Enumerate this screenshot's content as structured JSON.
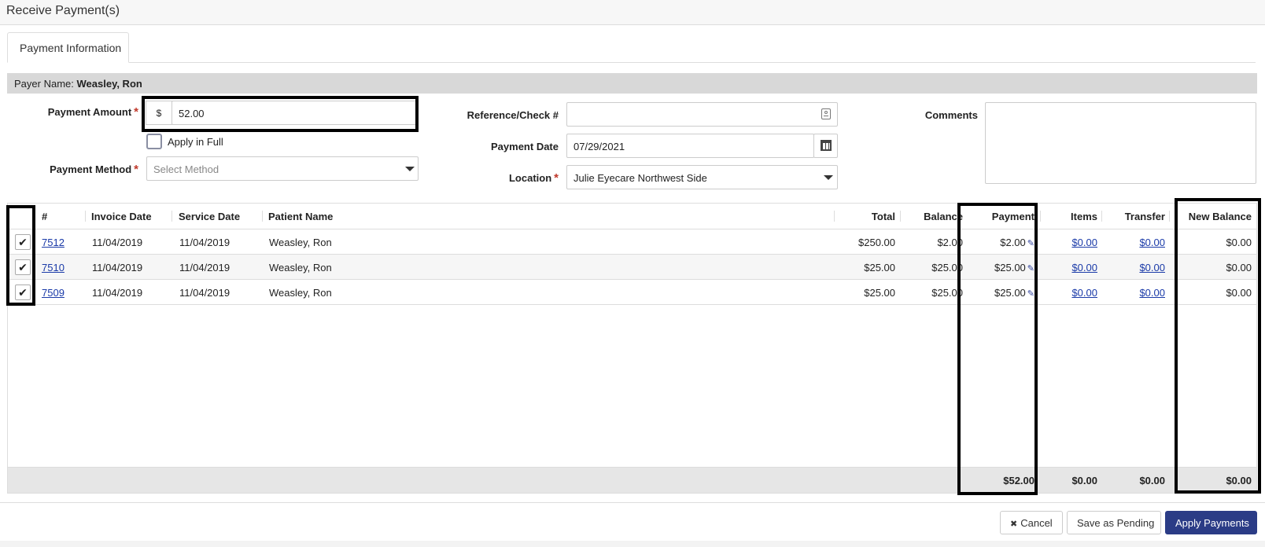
{
  "window": {
    "title": "Receive Payment(s)"
  },
  "tabs": [
    {
      "label": "Payment Information"
    }
  ],
  "payer": {
    "label": "Payer Name:",
    "name": "Weasley, Ron"
  },
  "form": {
    "payment_amount": {
      "label": "Payment Amount",
      "currency": "$",
      "value": "52.00"
    },
    "apply_in_full": {
      "label": "Apply in Full",
      "checked": false
    },
    "payment_method": {
      "label": "Payment Method",
      "placeholder": "Select Method"
    },
    "reference": {
      "label": "Reference/Check #",
      "value": ""
    },
    "payment_date": {
      "label": "Payment Date",
      "value": "07/29/2021"
    },
    "location": {
      "label": "Location",
      "value": "Julie Eyecare Northwest Side"
    },
    "comments": {
      "label": "Comments",
      "value": ""
    }
  },
  "grid": {
    "columns": {
      "num": "#",
      "invoice_date": "Invoice Date",
      "service_date": "Service Date",
      "patient": "Patient Name",
      "total": "Total",
      "balance": "Balance",
      "payment": "Payment",
      "items": "Items",
      "transfer": "Transfer",
      "new_balance": "New Balance"
    },
    "rows": [
      {
        "num": "7512",
        "invoice_date": "11/04/2019",
        "service_date": "11/04/2019",
        "patient": "Weasley, Ron",
        "total": "$250.00",
        "balance": "$2.00",
        "payment": "$2.00",
        "items": "$0.00",
        "transfer": "$0.00",
        "new_balance": "$0.00"
      },
      {
        "num": "7510",
        "invoice_date": "11/04/2019",
        "service_date": "11/04/2019",
        "patient": "Weasley, Ron",
        "total": "$25.00",
        "balance": "$25.00",
        "payment": "$25.00",
        "items": "$0.00",
        "transfer": "$0.00",
        "new_balance": "$0.00"
      },
      {
        "num": "7509",
        "invoice_date": "11/04/2019",
        "service_date": "11/04/2019",
        "patient": "Weasley, Ron",
        "total": "$25.00",
        "balance": "$25.00",
        "payment": "$25.00",
        "items": "$0.00",
        "transfer": "$0.00",
        "new_balance": "$0.00"
      }
    ],
    "totals": {
      "payment": "$52.00",
      "items": "$0.00",
      "transfer": "$0.00",
      "new_balance": "$0.00"
    }
  },
  "buttons": {
    "cancel": "Cancel",
    "save_pending": "Save as Pending",
    "apply": "Apply Payments"
  },
  "icons": {
    "check": "✔",
    "pencil": "✎",
    "close": "✖"
  },
  "colors": {
    "primary": "#2b3c86",
    "link": "#1a3aa8",
    "required": "#c0392b"
  }
}
